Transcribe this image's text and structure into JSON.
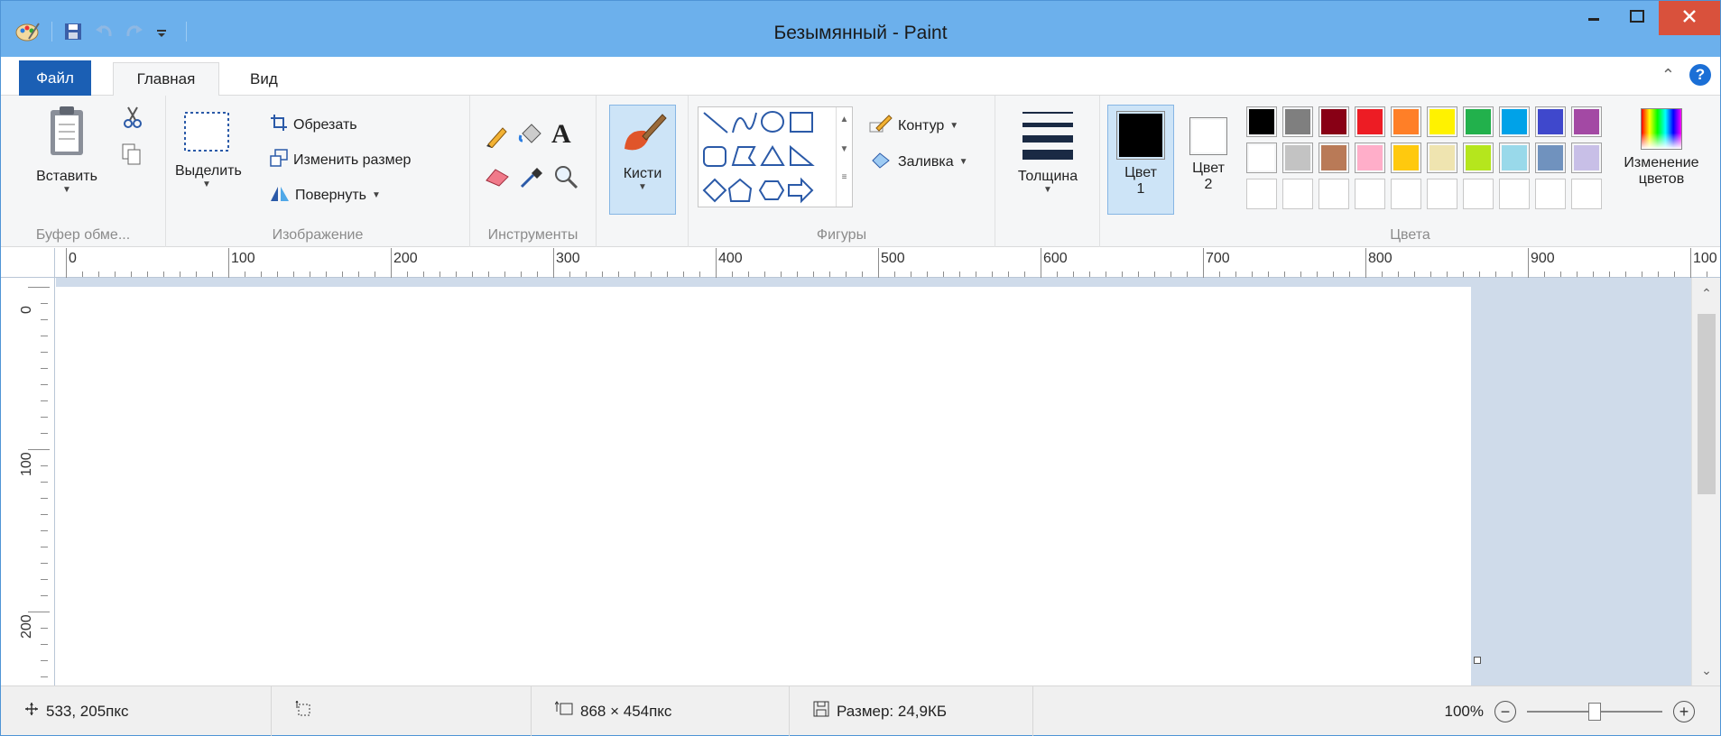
{
  "window": {
    "title": "Безымянный - Paint"
  },
  "tabs": {
    "file": "Файл",
    "home": "Главная",
    "view": "Вид"
  },
  "groups": {
    "clipboard": {
      "label": "Буфер обме...",
      "paste": "Вставить"
    },
    "image": {
      "label": "Изображение",
      "select": "Выделить",
      "crop": "Обрезать",
      "resize": "Изменить размер",
      "rotate": "Повернуть"
    },
    "tools": {
      "label": "Инструменты"
    },
    "brushes": {
      "label": "Кисти"
    },
    "shapes": {
      "label": "Фигуры",
      "outline": "Контур",
      "fill": "Заливка"
    },
    "size": {
      "label": "Толщина"
    },
    "colors": {
      "label": "Цвета",
      "color1_line1": "Цвет",
      "color1_line2": "1",
      "color2_line1": "Цвет",
      "color2_line2": "2",
      "edit_line1": "Изменение",
      "edit_line2": "цветов",
      "color1": "#000000",
      "color2": "#ffffff",
      "palette_row1": [
        "#000000",
        "#7f7f7f",
        "#880015",
        "#ed1c24",
        "#ff7f27",
        "#fff200",
        "#22b14c",
        "#00a2e8",
        "#3f48cc",
        "#a349a4"
      ],
      "palette_row2": [
        "#ffffff",
        "#c3c3c3",
        "#b97a57",
        "#ffaec9",
        "#ffc90e",
        "#efe4b0",
        "#b5e61d",
        "#99d9ea",
        "#7092be",
        "#c8bfe7"
      ],
      "palette_row3": [
        "",
        "",
        "",
        "",
        "",
        "",
        "",
        "",
        "",
        ""
      ]
    }
  },
  "ruler": {
    "h_labels": [
      "0",
      "100",
      "200",
      "300",
      "400",
      "500",
      "600",
      "700",
      "800",
      "900",
      "100"
    ],
    "v_labels": [
      "0",
      "100",
      "200"
    ]
  },
  "status": {
    "cursor_pos": "533, 205пкс",
    "canvas_size": "868 × 454пкс",
    "file_size": "Размер: 24,9КБ",
    "zoom": "100%"
  }
}
